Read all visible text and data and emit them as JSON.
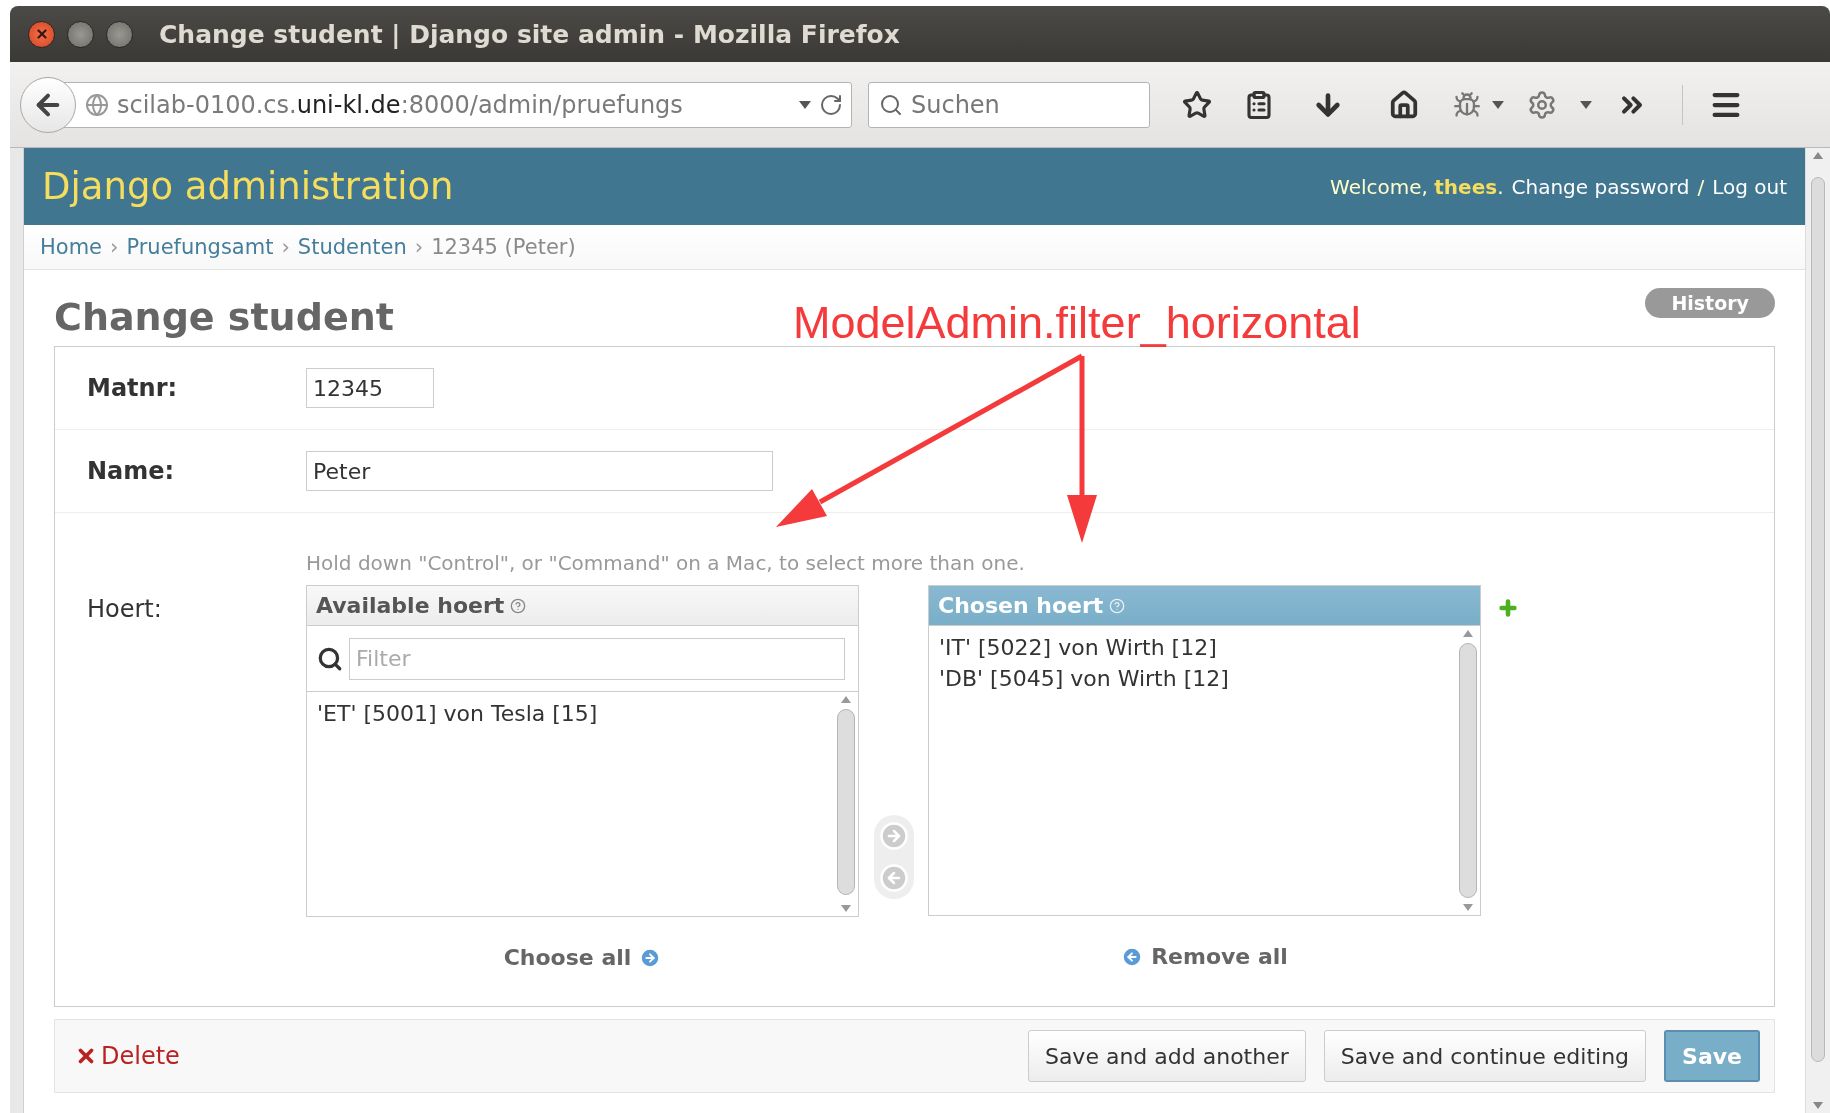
{
  "window": {
    "title": "Change student | Django site admin - Mozilla Firefox"
  },
  "browser": {
    "url_parts": [
      "scilab-0100.cs.",
      "uni-kl.de",
      ":8000/admin/pruefungs"
    ],
    "search_placeholder": "Suchen"
  },
  "header": {
    "brand": "Django administration",
    "welcome": "Welcome, **thees**.",
    "links": [
      "Change password",
      "Log out"
    ],
    "separator": "/"
  },
  "breadcrumbs": [
    {
      "label": "Home",
      "link": true
    },
    {
      "label": "Pruefungsamt",
      "link": true
    },
    {
      "label": "Studenten",
      "link": true
    },
    {
      "label": "12345 (Peter)",
      "link": false
    }
  ],
  "breadcrumb_separators": [
    "›",
    "›",
    "›"
  ],
  "page": {
    "title": "Change student",
    "history": "History"
  },
  "fields": [
    {
      "kind": "text",
      "label": "Matnr:",
      "value": "12345",
      "required": true,
      "wide": false
    },
    {
      "kind": "text",
      "label": "Name:",
      "value": "Peter",
      "required": true,
      "wide": true
    },
    {
      "kind": "filter_horizontal",
      "label": "Hoert:",
      "required": false,
      "help": "Hold down \"Control\", or \"Command\" on a Mac, to select more than one.",
      "available": {
        "title": "Available hoert",
        "filter_placeholder": "Filter",
        "options": [
          "'ET' [5001] von Tesla [15]"
        ],
        "action": "Choose all"
      },
      "chosen": {
        "title": "Chosen hoert",
        "options": [
          "'IT' [5022] von Wirth [12]",
          "'DB' [5045] von Wirth [12]"
        ],
        "action": "Remove all"
      }
    }
  ],
  "actions": {
    "delete": "Delete",
    "buttons": [
      {
        "label": "Save and add another",
        "default": false
      },
      {
        "label": "Save and continue editing",
        "default": false
      },
      {
        "label": "Save",
        "default": true
      }
    ]
  },
  "annotation": {
    "text": "ModelAdmin.filter_horizontal"
  }
}
